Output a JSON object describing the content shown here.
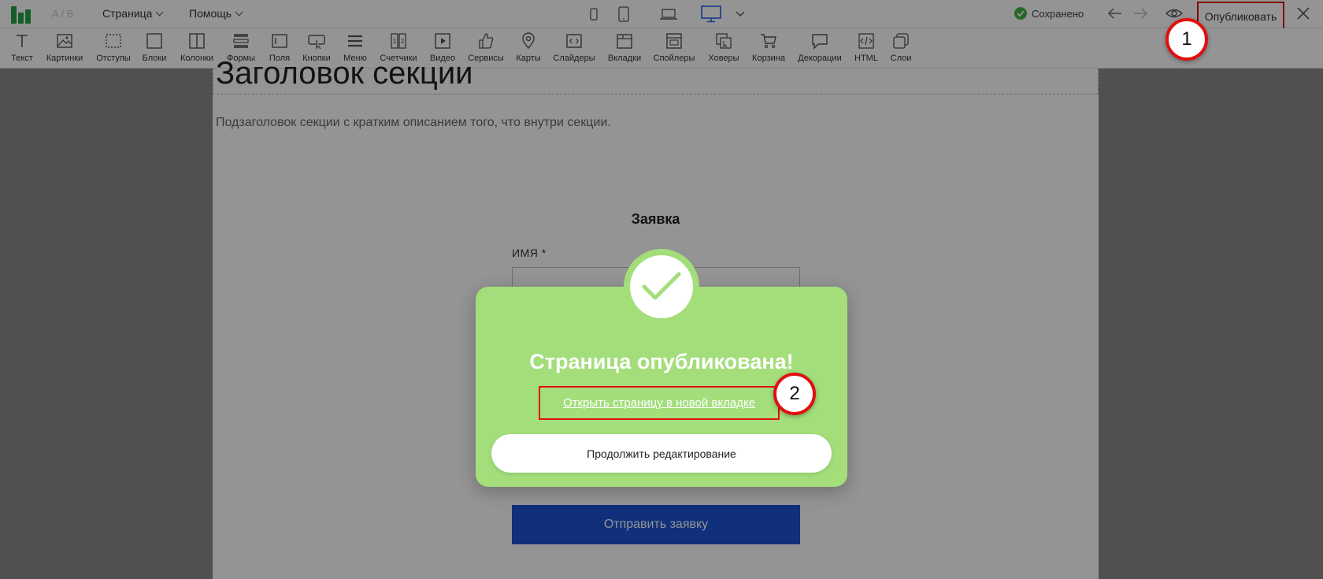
{
  "topbar": {
    "ab_test": "A / B",
    "menu": [
      {
        "label": "Страница"
      },
      {
        "label": "Помощь"
      }
    ],
    "status": "Сохранено",
    "publish_label": "Опубликовать"
  },
  "toolbar": {
    "tools": [
      {
        "label": "Текст",
        "icon": "text-icon"
      },
      {
        "label": "Картинки",
        "icon": "image-icon"
      },
      {
        "label": "Отступы",
        "icon": "spacing-icon"
      },
      {
        "label": "Блоки",
        "icon": "block-icon"
      },
      {
        "label": "Колонки",
        "icon": "columns-icon"
      },
      {
        "label": "Формы",
        "icon": "forms-icon"
      },
      {
        "label": "Поля",
        "icon": "fields-icon"
      },
      {
        "label": "Кнопки",
        "icon": "button-icon"
      },
      {
        "label": "Меню",
        "icon": "menu-icon"
      },
      {
        "label": "Счетчики",
        "icon": "counter-icon"
      },
      {
        "label": "Видео",
        "icon": "video-icon"
      },
      {
        "label": "Сервисы",
        "icon": "services-icon"
      },
      {
        "label": "Карты",
        "icon": "map-icon"
      },
      {
        "label": "Слайдеры",
        "icon": "slider-icon"
      },
      {
        "label": "Вкладки",
        "icon": "tabs-icon"
      },
      {
        "label": "Спойлеры",
        "icon": "spoiler-icon"
      },
      {
        "label": "Ховеры",
        "icon": "hover-icon"
      },
      {
        "label": "Корзина",
        "icon": "cart-icon"
      },
      {
        "label": "Декорации",
        "icon": "decoration-icon"
      },
      {
        "label": "HTML",
        "icon": "html-icon"
      },
      {
        "label": "Слои",
        "icon": "layers-icon"
      }
    ]
  },
  "canvas": {
    "section_title": "Заголовок секции",
    "section_subtitle": "Подзаголовок секции с кратким описанием того, что внутри секции.",
    "form_title": "Заявка",
    "field_label": "ИМЯ *",
    "submit_label": "Отправить заявку"
  },
  "modal": {
    "title": "Страница опубликована!",
    "open_link": "Открыть страницу в новой вкладке",
    "continue_label": "Продолжить редактирование"
  },
  "badges": [
    "1",
    "2"
  ],
  "colors": {
    "accent_green": "#27a244",
    "modal_green": "#a3de7b",
    "highlight_red": "#e01010",
    "submit_blue": "#1c54d4"
  }
}
